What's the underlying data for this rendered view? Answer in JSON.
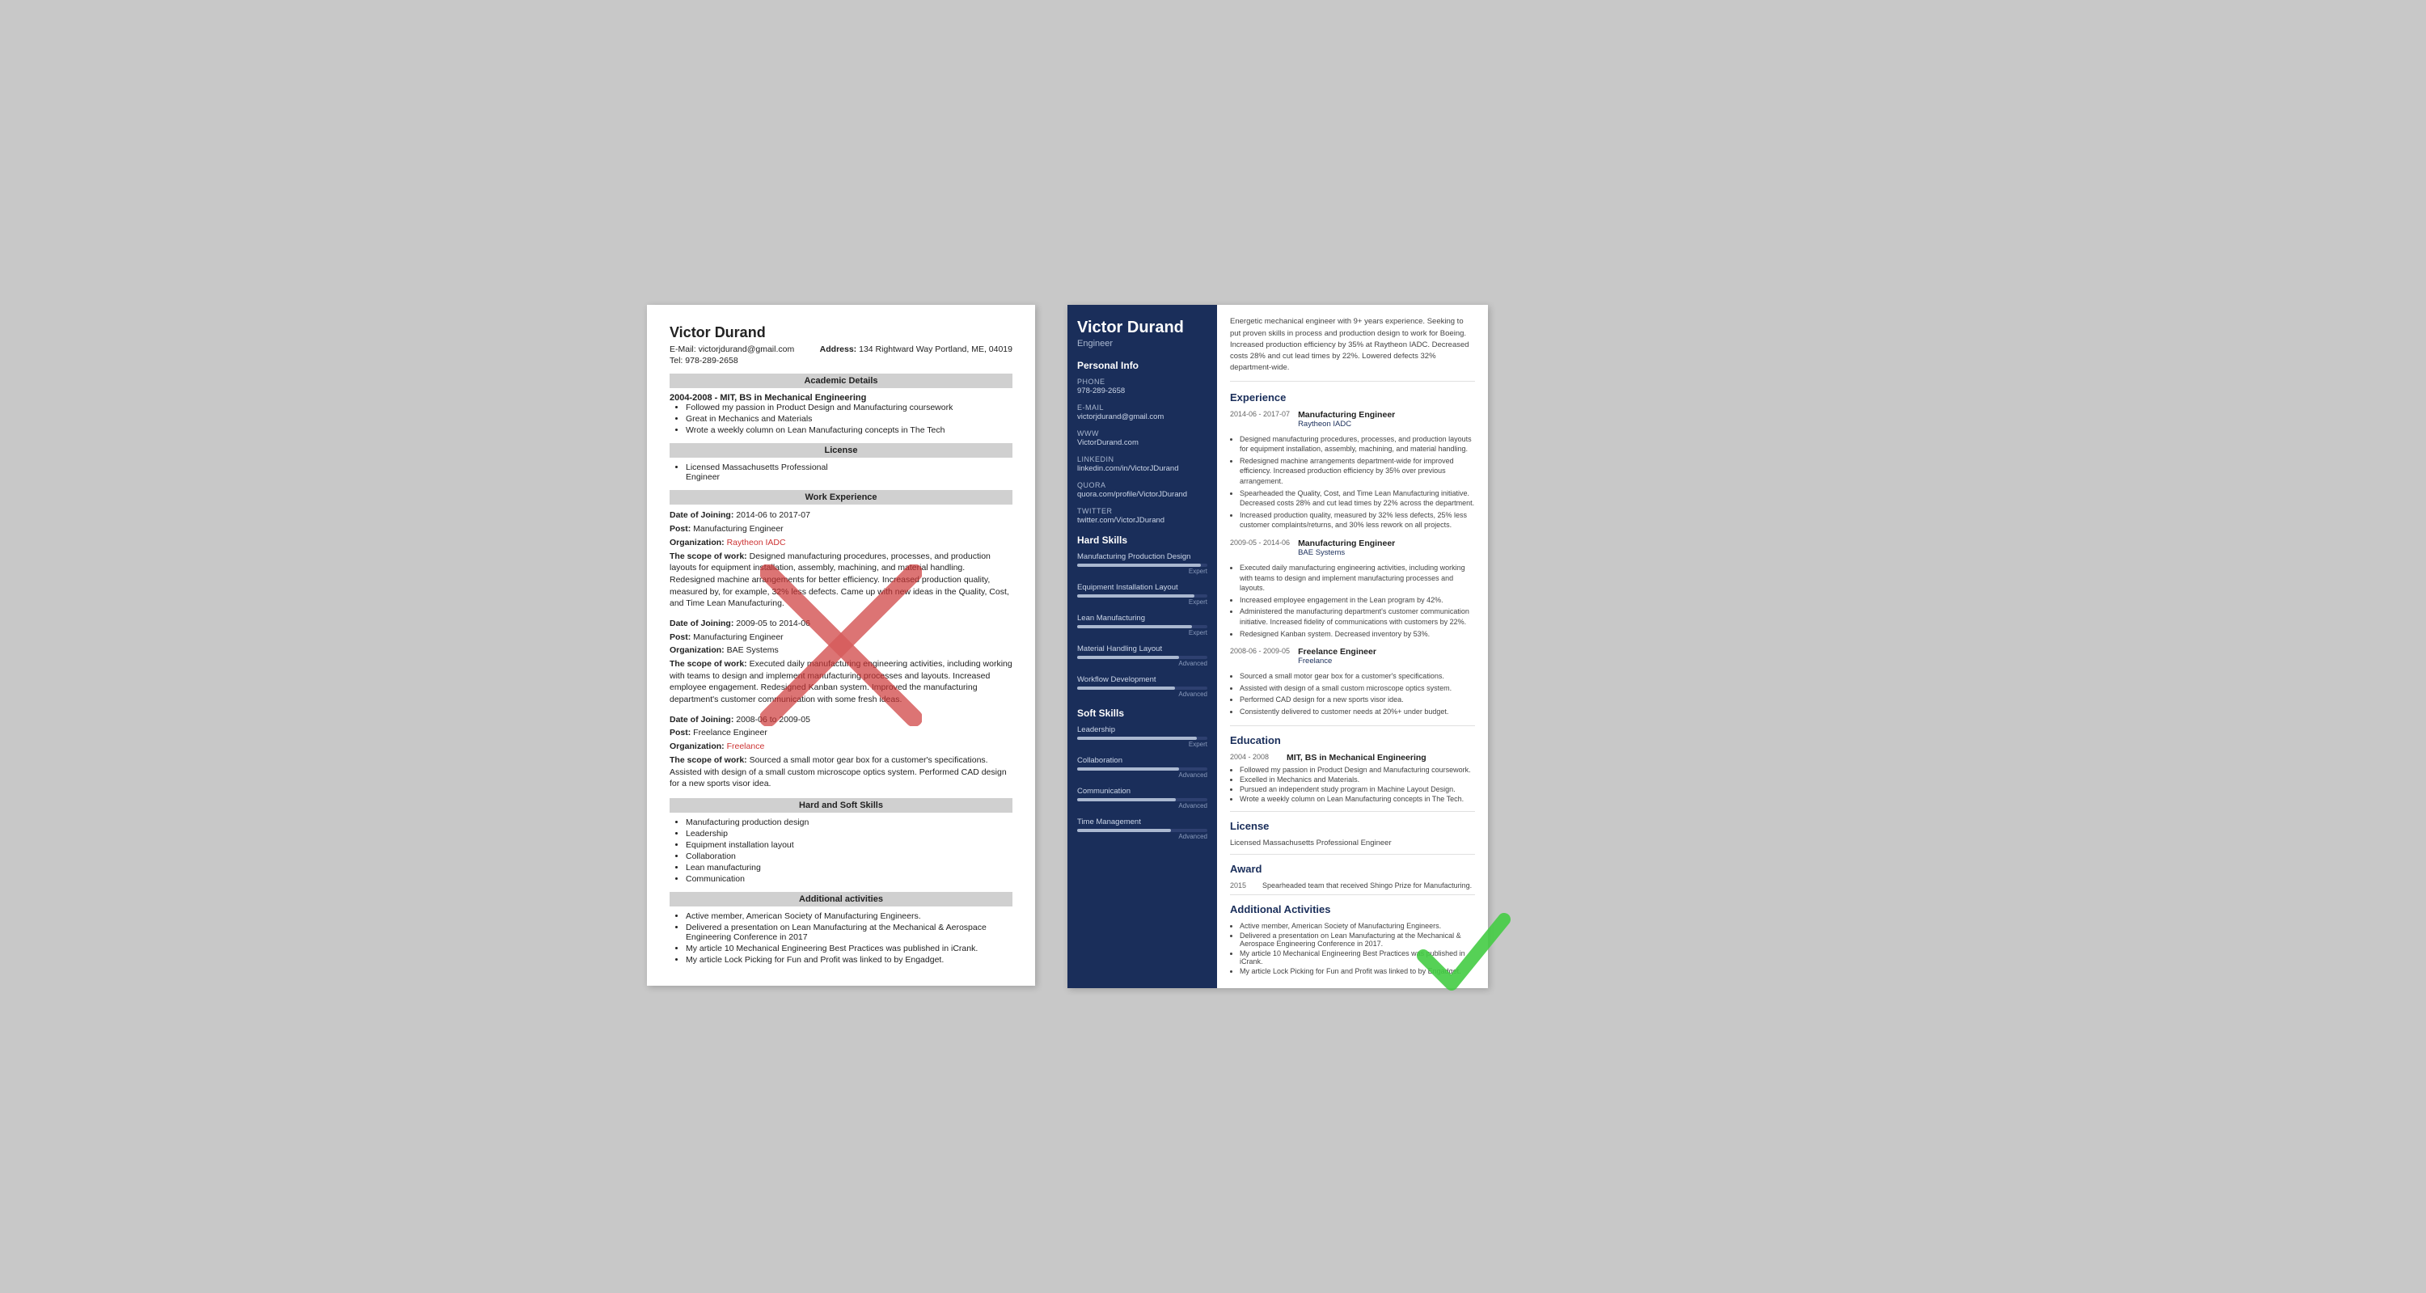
{
  "classic": {
    "name": "Victor Durand",
    "email_label": "E-Mail:",
    "email": "victorjdurand@gmail.com",
    "address_label": "Address:",
    "address": "134 Rightward Way Portland, ME, 04019",
    "tel_label": "Tel:",
    "tel": "978-289-2658",
    "sections": {
      "academic": "Academic Details",
      "license": "License",
      "work": "Work Experience",
      "hard_soft": "Hard and Soft Skills",
      "additional": "Additional activities"
    },
    "academic": {
      "dates": "2004-2008 -",
      "degree": "MIT, BS in Mechanical Engineering",
      "bullets": [
        "Followed my passion in Product Design and Manufacturing coursework",
        "Great in Mechanics and Materials",
        "Wrote a weekly column on Lean Manufacturing concepts in The Tech"
      ]
    },
    "license": {
      "bullets": [
        "Licensed Massachusetts Professional Engineer"
      ]
    },
    "work": [
      {
        "date_label": "Date of Joining:",
        "date": "2014-06 to 2017-07",
        "post_label": "Post:",
        "post": "Manufacturing Engineer",
        "org_label": "Organization:",
        "org": "Raytheon IADC",
        "scope_label": "The scope of work:",
        "scope": "Designed manufacturing procedures, processes, and production layouts for equipment installation, assembly, machining, and material handling. Redesigned machine arrangements for better efficiency. Increased production quality, measured by, for example, 32% less defects. Came up with new ideas in the Quality, Cost, and Time Lean Manufacturing."
      },
      {
        "date_label": "Date of Joining:",
        "date": "2009-05 to 2014-06",
        "post_label": "Post:",
        "post": "Manufacturing Engineer",
        "org_label": "Organization:",
        "org": "BAE Systems",
        "scope_label": "The scope of work:",
        "scope": "Executed daily manufacturing engineering activities, including working with teams to design and implement manufacturing processes and layouts. Increased employee engagement. Redesigned Kanban system. Improved the manufacturing department's customer communication with some fresh ideas."
      },
      {
        "date_label": "Date of Joining:",
        "date": "2008-06 to 2009-05",
        "post_label": "Post:",
        "post": "Freelance Engineer",
        "org_label": "Organization:",
        "org": "Freelance",
        "scope_label": "The scope of work:",
        "scope": "Sourced a small motor gear box for a customer's specifications. Assisted with design of a small custom microscope optics system. Performed CAD design for a new sports visor idea."
      }
    ],
    "skills": [
      "Manufacturing production design",
      "Leadership",
      "Equipment installation layout",
      "Collaboration",
      "Lean manufacturing",
      "Communication"
    ],
    "additional": [
      "Active member, American Society of Manufacturing Engineers.",
      "Delivered a presentation on Lean Manufacturing at the Mechanical & Aerospace Engineering Conference in 2017",
      "My article 10 Mechanical Engineering Best Practices was published in iCrank.",
      "My article Lock Picking for Fun and Profit was linked to by Engadget."
    ]
  },
  "modern": {
    "name": "Victor Durand",
    "title": "Engineer",
    "summary": "Energetic mechanical engineer with 9+ years experience. Seeking to put proven skills in process and production design to work for Boeing. Increased production efficiency by 35% at Raytheon IADC. Decreased costs 28% and cut lead times by 22%. Lowered defects 32% department-wide.",
    "personal_info": {
      "section_title": "Personal Info",
      "phone_label": "Phone",
      "phone": "978-289-2658",
      "email_label": "E-mail",
      "email": "victorjdurand@gmail.com",
      "www_label": "WWW",
      "www": "VictorDurand.com",
      "linkedin_label": "LinkedIn",
      "linkedin": "linkedin.com/in/VictorJDurand",
      "quora_label": "Quora",
      "quora": "quora.com/profile/VictorJDurand",
      "twitter_label": "Twitter",
      "twitter": "twitter.com/VictorJDurand"
    },
    "hard_skills": {
      "section_title": "Hard Skills",
      "items": [
        {
          "name": "Manufacturing Production Design",
          "level": "Expert",
          "pct": 95
        },
        {
          "name": "Equipment Installation Layout",
          "level": "Expert",
          "pct": 90
        },
        {
          "name": "Lean Manufacturing",
          "level": "Expert",
          "pct": 88
        },
        {
          "name": "Material Handling Layout",
          "level": "Advanced",
          "pct": 78
        },
        {
          "name": "Workflow Development",
          "level": "Advanced",
          "pct": 75
        }
      ]
    },
    "soft_skills": {
      "section_title": "Soft Skills",
      "items": [
        {
          "name": "Leadership",
          "level": "Expert",
          "pct": 92
        },
        {
          "name": "Collaboration",
          "level": "Advanced",
          "pct": 78
        },
        {
          "name": "Communication",
          "level": "Advanced",
          "pct": 76
        },
        {
          "name": "Time Management",
          "level": "Advanced",
          "pct": 72
        }
      ]
    },
    "experience": {
      "section_title": "Experience",
      "items": [
        {
          "dates": "2014-06 - 2017-07",
          "role": "Manufacturing Engineer",
          "company": "Raytheon IADC",
          "bullets": [
            "Designed manufacturing procedures, processes, and production layouts for equipment installation, assembly, machining, and material handling.",
            "Redesigned machine arrangements department-wide for improved efficiency. Increased production efficiency by 35% over previous arrangement.",
            "Spearheaded the Quality, Cost, and Time Lean Manufacturing initiative. Decreased costs 28% and cut lead times by 22% across the department.",
            "Increased production quality, measured by 32% less defects, 25% less customer complaints/returns, and 30% less rework on all projects."
          ]
        },
        {
          "dates": "2009-05 - 2014-06",
          "role": "Manufacturing Engineer",
          "company": "BAE Systems",
          "bullets": [
            "Executed daily manufacturing engineering activities, including working with teams to design and implement manufacturing processes and layouts.",
            "Increased employee engagement in the Lean program by 42%.",
            "Administered the manufacturing department's customer communication initiative. Increased fidelity of communications with customers by 22%.",
            "Redesigned Kanban system. Decreased inventory by 53%."
          ]
        },
        {
          "dates": "2008-06 - 2009-05",
          "role": "Freelance Engineer",
          "company": "Freelance",
          "bullets": [
            "Sourced a small motor gear box for a customer's specifications.",
            "Assisted with design of a small custom microscope optics system.",
            "Performed CAD design for a new sports visor idea.",
            "Consistently delivered to customer needs at 20%+ under budget."
          ]
        }
      ]
    },
    "education": {
      "section_title": "Education",
      "items": [
        {
          "dates": "2004 - 2008",
          "degree": "MIT, BS in Mechanical Engineering",
          "bullets": [
            "Followed my passion in Product Design and Manufacturing coursework.",
            "Excelled in Mechanics and Materials.",
            "Pursued an independent study program in Machine Layout Design.",
            "Wrote a weekly column on Lean Manufacturing concepts in The Tech."
          ]
        }
      ]
    },
    "license": {
      "section_title": "License",
      "text": "Licensed Massachusetts Professional Engineer"
    },
    "award": {
      "section_title": "Award",
      "year": "2015",
      "text": "Spearheaded team that received Shingo Prize for Manufacturing."
    },
    "additional": {
      "section_title": "Additional Activities",
      "bullets": [
        "Active member, American Society of Manufacturing Engineers.",
        "Delivered a presentation on Lean Manufacturing at the Mechanical & Aerospace Engineering Conference in 2017.",
        "My article 10 Mechanical Engineering Best Practices was published in iCrank.",
        "My article Lock Picking for Fun and Profit was linked to by Engadget."
      ]
    }
  }
}
